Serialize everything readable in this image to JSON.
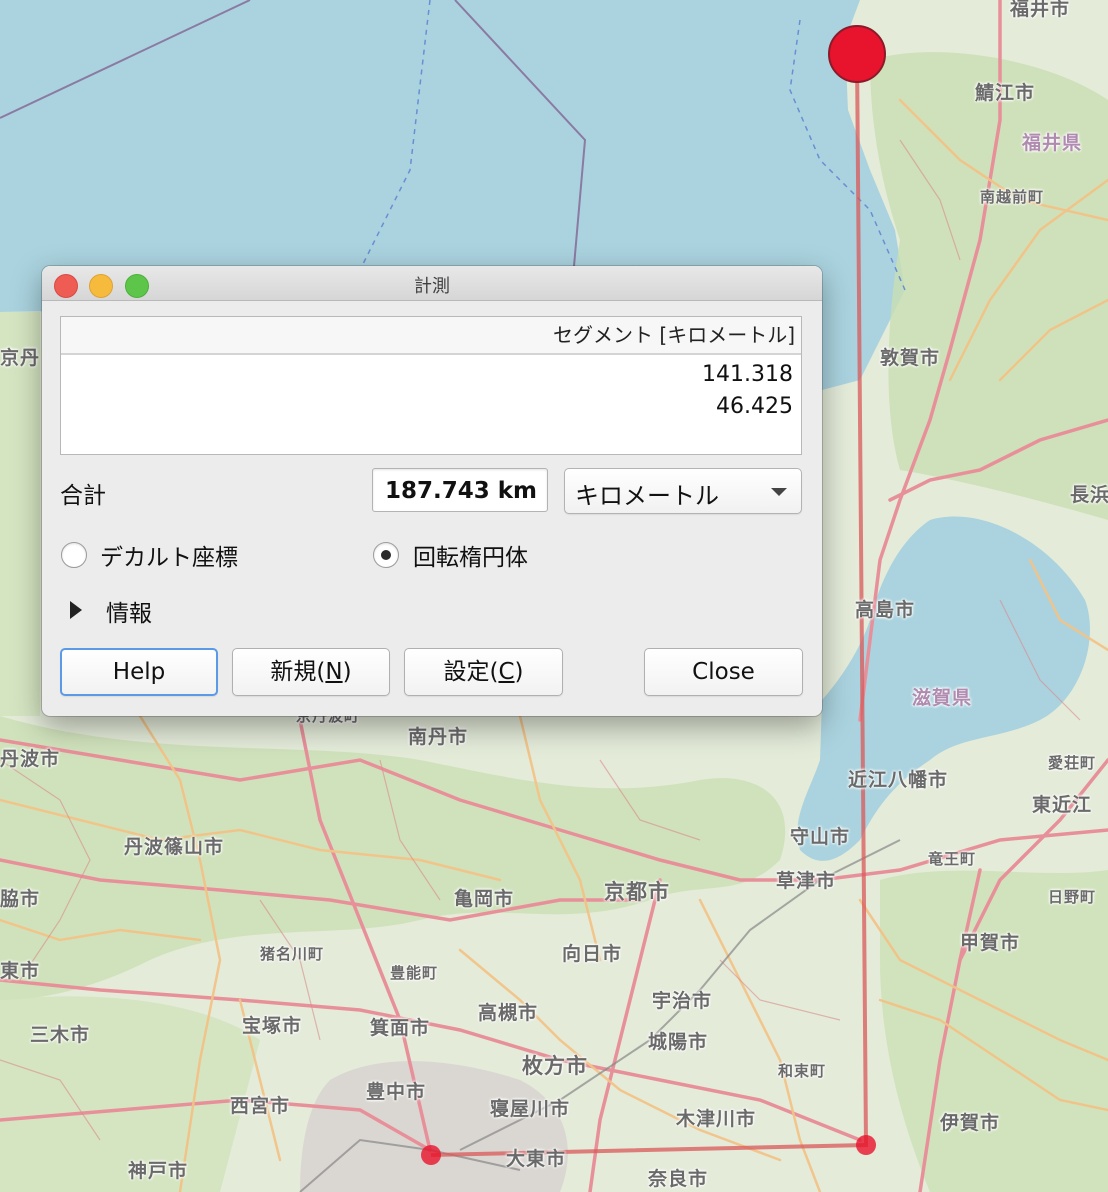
{
  "map": {
    "labels": [
      {
        "text": "福井市",
        "cls": "mid"
      },
      {
        "text": "鯖江市",
        "cls": "mid"
      },
      {
        "text": "福井県",
        "cls": "pref"
      },
      {
        "text": "南越前町",
        "cls": "small"
      },
      {
        "text": "敦賀市",
        "cls": "mid"
      },
      {
        "text": "京丹",
        "cls": "mid"
      },
      {
        "text": "長浜",
        "cls": "mid"
      },
      {
        "text": "高島市",
        "cls": "mid"
      },
      {
        "text": "滋賀県",
        "cls": "pref"
      },
      {
        "text": "京丹波町",
        "cls": "small"
      },
      {
        "text": "南丹市",
        "cls": "mid"
      },
      {
        "text": "丹波市",
        "cls": "mid"
      },
      {
        "text": "近江八幡市",
        "cls": "mid"
      },
      {
        "text": "愛荘町",
        "cls": "small"
      },
      {
        "text": "東近江",
        "cls": "mid"
      },
      {
        "text": "丹波篠山市",
        "cls": "mid"
      },
      {
        "text": "守山市",
        "cls": "mid"
      },
      {
        "text": "竜王町",
        "cls": "small"
      },
      {
        "text": "草津市",
        "cls": "mid"
      },
      {
        "text": "日野町",
        "cls": "small"
      },
      {
        "text": "亀岡市",
        "cls": "mid"
      },
      {
        "text": "京都市",
        "cls": "big"
      },
      {
        "text": "脇市",
        "cls": "mid"
      },
      {
        "text": "向日市",
        "cls": "mid"
      },
      {
        "text": "猪名川町",
        "cls": "small"
      },
      {
        "text": "甲賀市",
        "cls": "mid"
      },
      {
        "text": "東市",
        "cls": "mid"
      },
      {
        "text": "豊能町",
        "cls": "small"
      },
      {
        "text": "宇治市",
        "cls": "mid"
      },
      {
        "text": "三木市",
        "cls": "mid"
      },
      {
        "text": "宝塚市",
        "cls": "mid"
      },
      {
        "text": "箕面市",
        "cls": "mid"
      },
      {
        "text": "高槻市",
        "cls": "mid"
      },
      {
        "text": "城陽市",
        "cls": "mid"
      },
      {
        "text": "枚方市",
        "cls": "big"
      },
      {
        "text": "和束町",
        "cls": "small"
      },
      {
        "text": "豊中市",
        "cls": "mid"
      },
      {
        "text": "西宮市",
        "cls": "mid"
      },
      {
        "text": "寝屋川市",
        "cls": "mid"
      },
      {
        "text": "木津川市",
        "cls": "mid"
      },
      {
        "text": "伊賀市",
        "cls": "mid"
      },
      {
        "text": "大東市",
        "cls": "mid"
      },
      {
        "text": "神戸市",
        "cls": "mid"
      },
      {
        "text": "奈良市",
        "cls": "mid"
      }
    ],
    "colors": {
      "sea": "#aad3df",
      "land": "#e4ebd9",
      "forest": "#c7deb0",
      "road_primary": "#e8909a",
      "road_secondary": "#f2c387",
      "measure_line": "#d9585a",
      "measure_point": "#e8132c"
    }
  },
  "dialog": {
    "title": "計測",
    "table_header": "セグメント [キロメートル]",
    "segments": [
      "141.318",
      "46.425"
    ],
    "total_label": "合計",
    "total_value": "187.743 km",
    "unit_selected": "キロメートル",
    "radio_cartesian": "デカルト座標",
    "radio_ellipsoidal": "回転楕円体",
    "info_label": "情報",
    "buttons": {
      "help": "Help",
      "new_pre": "新規(",
      "new_key": "N",
      "new_post": ")",
      "settings_pre": "設定(",
      "settings_key": "C",
      "settings_post": ")",
      "close": "Close"
    }
  }
}
